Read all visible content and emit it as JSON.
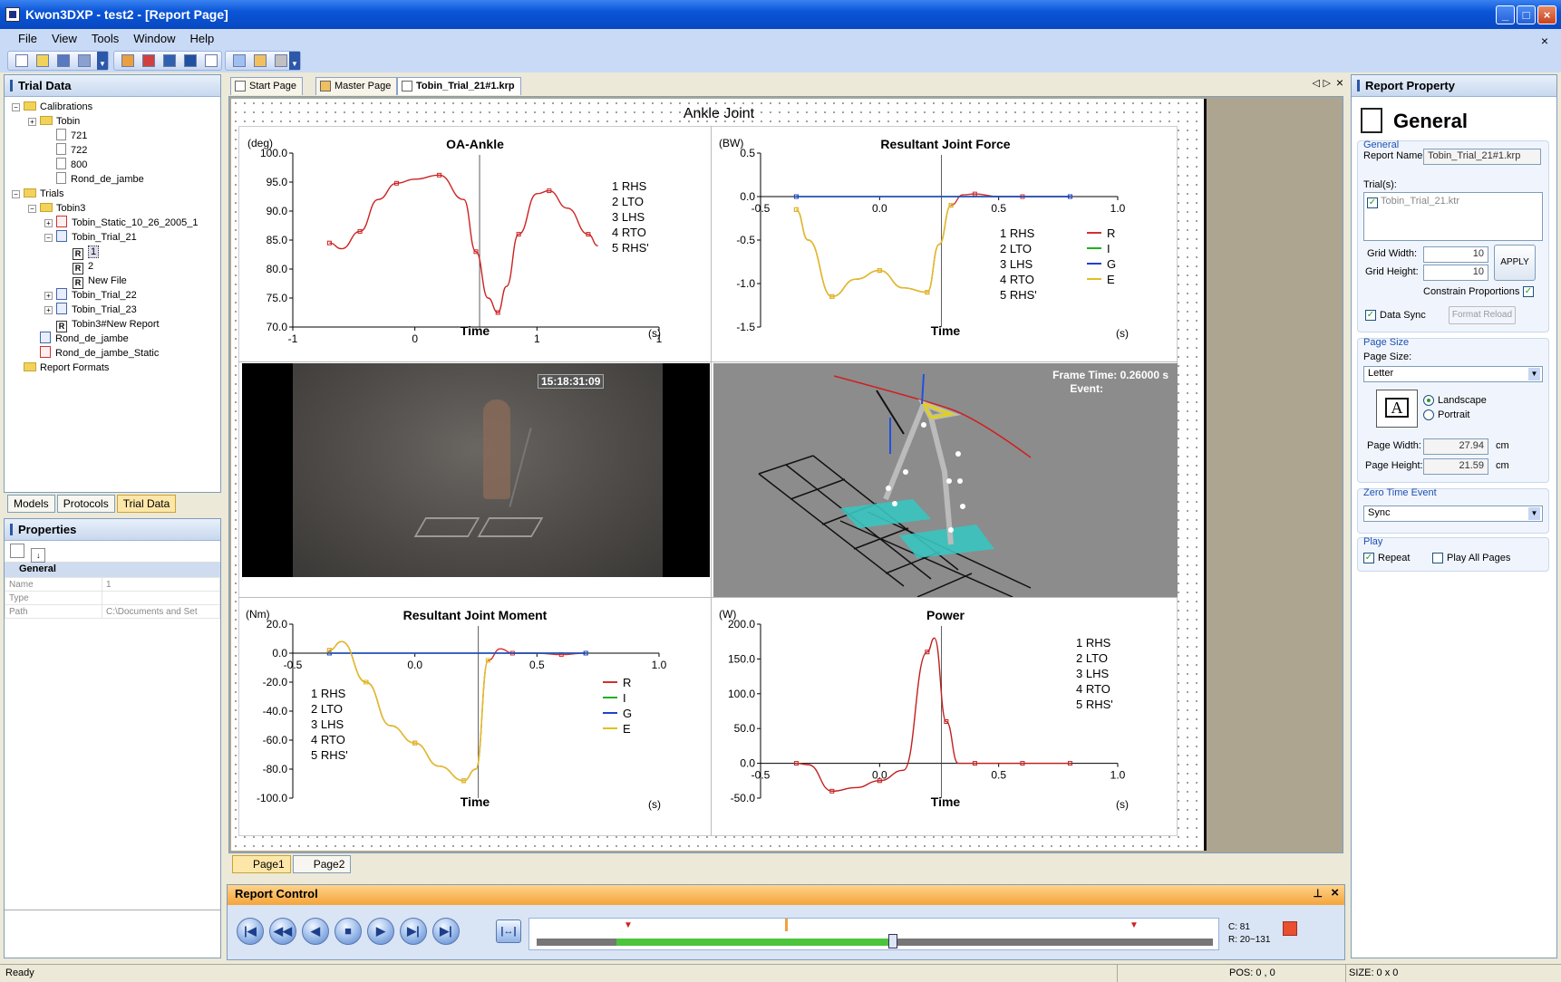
{
  "window": {
    "title": "Kwon3DXP - test2 - [Report Page]"
  },
  "menu": [
    "File",
    "View",
    "Tools",
    "Window",
    "Help"
  ],
  "trial_data": {
    "title": "Trial Data",
    "tree": [
      {
        "label": "Calibrations",
        "icon": "folder",
        "indent": 0,
        "pm": "−"
      },
      {
        "label": "Tobin",
        "icon": "folder",
        "indent": 1,
        "pm": "+"
      },
      {
        "label": "721",
        "icon": "doc",
        "indent": 2,
        "pm": ""
      },
      {
        "label": "722",
        "icon": "doc",
        "indent": 2,
        "pm": ""
      },
      {
        "label": "800",
        "icon": "doc",
        "indent": 2,
        "pm": ""
      },
      {
        "label": "Rond_de_jambe",
        "icon": "doc",
        "indent": 2,
        "pm": ""
      },
      {
        "label": "Trials",
        "icon": "folder",
        "indent": 0,
        "pm": "−"
      },
      {
        "label": "Tobin3",
        "icon": "folder",
        "indent": 1,
        "pm": "−"
      },
      {
        "label": "Tobin_Static_10_26_2005_1",
        "icon": "trialr",
        "indent": 2,
        "pm": "+"
      },
      {
        "label": "Tobin_Trial_21",
        "icon": "trial",
        "indent": 2,
        "pm": "−"
      },
      {
        "label": "1",
        "icon": "rep",
        "indent": 3,
        "pm": "",
        "selected": true
      },
      {
        "label": "2",
        "icon": "rep",
        "indent": 3,
        "pm": ""
      },
      {
        "label": "New File",
        "icon": "rep",
        "indent": 3,
        "pm": ""
      },
      {
        "label": "Tobin_Trial_22",
        "icon": "trial",
        "indent": 2,
        "pm": "+"
      },
      {
        "label": "Tobin_Trial_23",
        "icon": "trial",
        "indent": 2,
        "pm": "+"
      },
      {
        "label": "Tobin3#New Report",
        "icon": "rep",
        "indent": 2,
        "pm": ""
      },
      {
        "label": "Rond_de_jambe",
        "icon": "trial",
        "indent": 1,
        "pm": ""
      },
      {
        "label": "Rond_de_jambe_Static",
        "icon": "trialr",
        "indent": 1,
        "pm": ""
      },
      {
        "label": "Report Formats",
        "icon": "folder",
        "indent": 0,
        "pm": ""
      }
    ],
    "bottom_tabs": [
      "Models",
      "Protocols",
      "Trial Data"
    ]
  },
  "properties": {
    "title": "Properties",
    "section": "General",
    "rows": [
      {
        "name": "Name",
        "value": "1"
      },
      {
        "name": "Type",
        "value": ""
      },
      {
        "name": "Path",
        "value": "C:\\Documents and Set"
      }
    ]
  },
  "doc_tabs": [
    "Start Page",
    "Master Page",
    "Tobin_Trial_21#1.krp"
  ],
  "page_tabs": [
    "Page1",
    "Page2"
  ],
  "report": {
    "title": "Ankle Joint",
    "oa": {
      "title": "OA-Ankle",
      "unit": "(deg)",
      "xlabel": "Time",
      "xunit": "(s)"
    },
    "force": {
      "title": "Resultant Joint Force",
      "unit": "(BW)",
      "xlabel": "Time",
      "xunit": "(s)"
    },
    "moment": {
      "title": "Resultant Joint Moment",
      "unit": "(Nm)",
      "xlabel": "Time",
      "xunit": "(s)"
    },
    "power": {
      "title": "Power",
      "unit": "(W)",
      "xlabel": "Time",
      "xunit": "(s)"
    },
    "events": [
      "1 RHS",
      "2 LTO",
      "3 LHS",
      "4 RTO",
      "5 RHS'"
    ],
    "components": [
      "R",
      "I",
      "G",
      "E"
    ],
    "video_timestamp": "15:18:31:09",
    "frame_time": "Frame Time: 0.26000 s",
    "event_label": "Event:"
  },
  "chart_data": [
    {
      "type": "line",
      "title": "OA-Ankle",
      "ylabel": "(deg)",
      "xlabel": "Time",
      "xlim": [
        -1,
        1
      ],
      "ylim": [
        70,
        100
      ],
      "xticks": [
        "-1",
        "0",
        "1",
        "1"
      ],
      "yticks": [
        "100.0",
        "95.0",
        "90.0",
        "85.0",
        "80.0",
        "75.0",
        "70.0"
      ],
      "series": [
        {
          "color": "#cc2222",
          "x": [
            -0.7,
            -0.6,
            -0.45,
            -0.3,
            -0.15,
            0.0,
            0.2,
            0.4,
            0.5,
            0.6,
            0.68,
            0.75,
            0.85,
            1.0,
            1.1,
            1.25,
            1.42,
            1.5
          ],
          "y": [
            84.5,
            83.5,
            86.5,
            92.0,
            94.8,
            95.5,
            96.2,
            92.0,
            83.0,
            75.0,
            72.5,
            77.0,
            86.0,
            93.0,
            93.5,
            90.5,
            86.0,
            84.0
          ]
        }
      ]
    },
    {
      "type": "line",
      "title": "Resultant Joint Force",
      "ylabel": "(BW)",
      "xlabel": "Time",
      "xlim": [
        -0.5,
        1.0
      ],
      "ylim": [
        -1.5,
        0.5
      ],
      "xticks": [
        "-0.5",
        "0.0",
        "0.5",
        "1.0"
      ],
      "yticks": [
        "0.5",
        "0.0",
        "-0.5",
        "-1.0",
        "-1.5"
      ],
      "series": [
        {
          "name": "R",
          "color": "#d03030",
          "x": [
            -0.35,
            -0.3,
            -0.2,
            -0.1,
            0.0,
            0.1,
            0.2,
            0.25,
            0.3,
            0.35,
            0.4,
            0.5,
            0.6,
            0.7,
            0.8
          ],
          "y": [
            -0.15,
            -0.5,
            -1.15,
            -0.95,
            -0.85,
            -1.05,
            -1.1,
            -0.55,
            -0.1,
            0.02,
            0.03,
            0.0,
            0.0,
            0.0,
            0.0
          ]
        },
        {
          "name": "I",
          "color": "#20b020",
          "x": [
            -0.35,
            0.8
          ],
          "y": [
            0.0,
            0.0
          ]
        },
        {
          "name": "G",
          "color": "#2040d0",
          "x": [
            -0.35,
            0.8
          ],
          "y": [
            0.0,
            0.0
          ]
        },
        {
          "name": "E",
          "color": "#e0c020",
          "x": [
            -0.35,
            -0.3,
            -0.2,
            -0.1,
            0.0,
            0.1,
            0.2,
            0.25,
            0.3
          ],
          "y": [
            -0.15,
            -0.5,
            -1.15,
            -0.95,
            -0.85,
            -1.05,
            -1.1,
            -0.55,
            -0.1
          ]
        }
      ]
    },
    {
      "type": "line",
      "title": "Resultant Joint Moment",
      "ylabel": "(Nm)",
      "xlabel": "Time",
      "xlim": [
        -0.5,
        1.0
      ],
      "ylim": [
        -100,
        20
      ],
      "xticks": [
        "-0.5",
        "0.0",
        "0.5",
        "1.0"
      ],
      "yticks": [
        "20.0",
        "0.0",
        "-20.0",
        "-40.0",
        "-60.0",
        "-80.0",
        "-100.0"
      ],
      "series": [
        {
          "name": "R",
          "color": "#d03030",
          "x": [
            -0.35,
            -0.3,
            -0.2,
            -0.1,
            0.0,
            0.1,
            0.2,
            0.25,
            0.3,
            0.35,
            0.4,
            0.5,
            0.6,
            0.7
          ],
          "y": [
            2,
            8,
            -20,
            -50,
            -62,
            -78,
            -88,
            -80,
            -5,
            3,
            0,
            0,
            -1,
            0
          ]
        },
        {
          "name": "I",
          "color": "#20b020",
          "x": [
            -0.35,
            0.7
          ],
          "y": [
            0,
            0
          ]
        },
        {
          "name": "G",
          "color": "#2040d0",
          "x": [
            -0.35,
            0.7
          ],
          "y": [
            0,
            0
          ]
        },
        {
          "name": "E",
          "color": "#e0c020",
          "x": [
            -0.35,
            -0.3,
            -0.2,
            -0.1,
            0.0,
            0.1,
            0.2,
            0.25,
            0.3
          ],
          "y": [
            2,
            8,
            -20,
            -50,
            -62,
            -78,
            -88,
            -80,
            -5
          ]
        }
      ]
    },
    {
      "type": "line",
      "title": "Power",
      "ylabel": "(W)",
      "xlabel": "Time",
      "xlim": [
        -0.5,
        1.0
      ],
      "ylim": [
        -50,
        200
      ],
      "xticks": [
        "-0.5",
        "0.0",
        "0.5",
        "1.0"
      ],
      "yticks": [
        "200.0",
        "150.0",
        "100.0",
        "50.0",
        "0.0",
        "-50.0"
      ],
      "series": [
        {
          "color": "#c02020",
          "x": [
            -0.35,
            -0.3,
            -0.2,
            -0.1,
            0.0,
            0.1,
            0.2,
            0.23,
            0.28,
            0.33,
            0.4,
            0.5,
            0.6,
            0.7,
            0.8
          ],
          "y": [
            0,
            -2,
            -40,
            -35,
            -25,
            -10,
            160,
            180,
            60,
            0,
            0,
            0,
            0,
            0,
            0
          ]
        }
      ]
    }
  ],
  "report_property": {
    "title": "Report Property",
    "heading": "General",
    "general_group": "General",
    "report_name_label": "Report Name:",
    "report_name": "Tobin_Trial_21#1.krp",
    "trials_label": "Trial(s):",
    "trial_item": "Tobin_Trial_21.ktr",
    "grid_width_label": "Grid Width:",
    "grid_width": "10",
    "grid_height_label": "Grid Height:",
    "grid_height": "10",
    "apply": "APPLY",
    "constrain": "Constrain Proportions",
    "data_sync": "Data Sync",
    "format_reload": "Format Reload",
    "page_size_group": "Page Size",
    "page_size_label": "Page Size:",
    "page_size": "Letter",
    "landscape": "Landscape",
    "portrait": "Portrait",
    "page_width_label": "Page Width:",
    "page_width": "27.94",
    "page_height_label": "Page Height:",
    "page_height": "21.59",
    "cm": "cm",
    "zero_time_group": "Zero Time Event",
    "zero_time": "Sync",
    "play_group": "Play",
    "repeat": "Repeat",
    "play_all": "Play All Pages"
  },
  "report_control": {
    "title": "Report Control",
    "current": "C: 81",
    "range": "R: 20~131",
    "progress": 0.54
  },
  "status": {
    "left": "Ready",
    "pos": "POS: 0 , 0",
    "size": "SIZE: 0 x 0"
  }
}
